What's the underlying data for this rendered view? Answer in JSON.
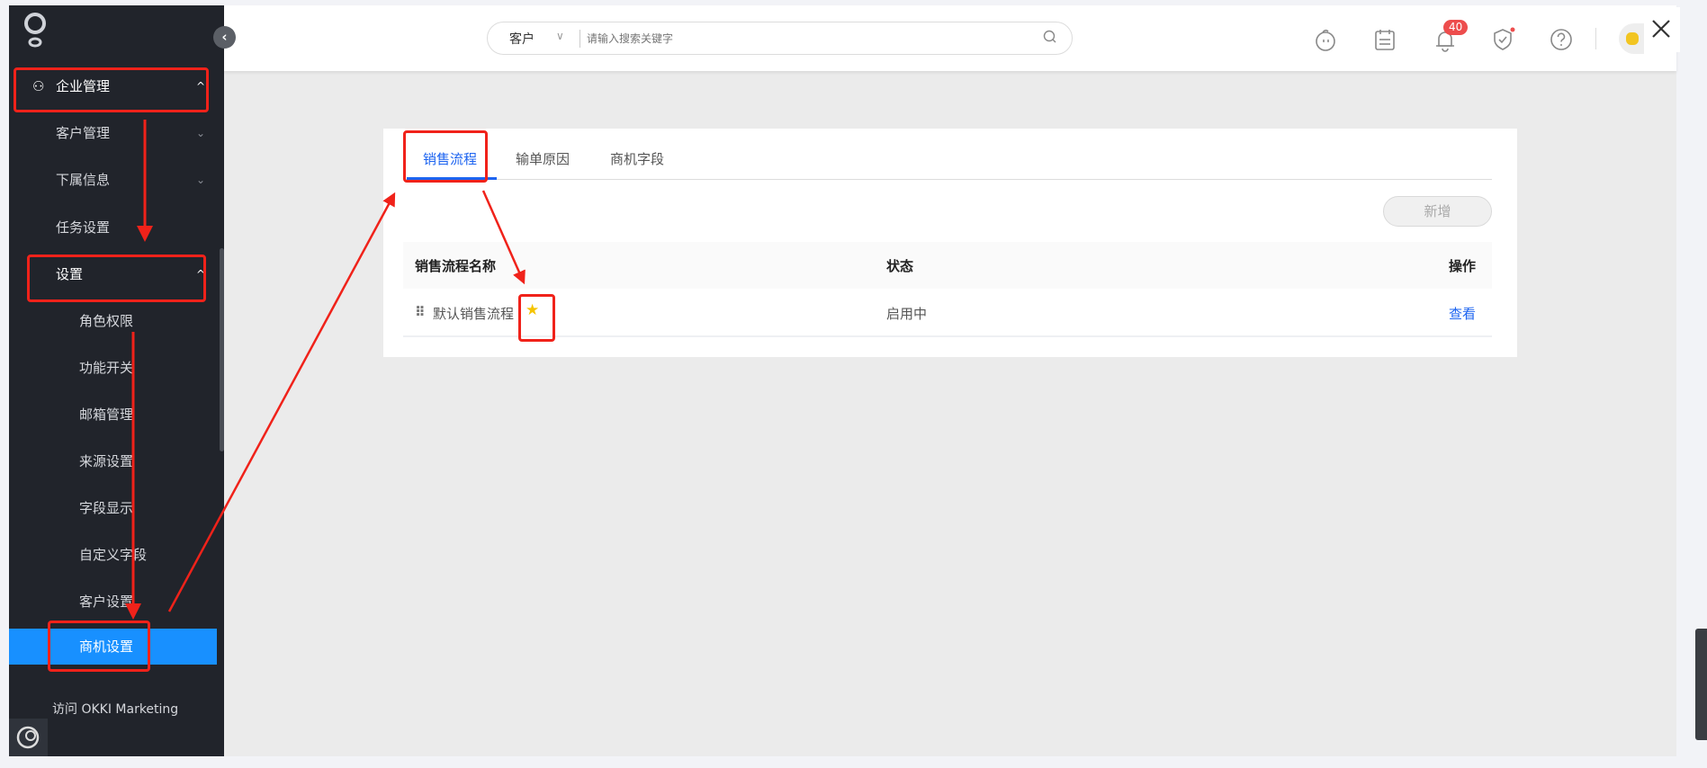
{
  "sidebar": {
    "items": [
      {
        "label": "企业管理",
        "level": 1,
        "expanded": true
      },
      {
        "label": "客户管理",
        "level": 2
      },
      {
        "label": "下属信息",
        "level": 2
      },
      {
        "label": "任务设置",
        "level": 2
      },
      {
        "label": "设置",
        "level": 2,
        "expanded": true
      },
      {
        "label": "角色权限",
        "level": 3
      },
      {
        "label": "功能开关",
        "level": 3
      },
      {
        "label": "邮箱管理",
        "level": 3
      },
      {
        "label": "来源设置",
        "level": 3
      },
      {
        "label": "字段显示",
        "level": 3
      },
      {
        "label": "自定义字段",
        "level": 3
      },
      {
        "label": "客户设置",
        "level": 3
      },
      {
        "label": "商机设置",
        "level": 3,
        "active": true
      }
    ],
    "footer_link": "访问 OKKI Marketing"
  },
  "header": {
    "search_scope": "客户",
    "search_placeholder": "请输入搜索关键字",
    "notification_count": "40"
  },
  "tabs": [
    "销售流程",
    "输单原因",
    "商机字段"
  ],
  "new_button": "新增",
  "table": {
    "columns": [
      "销售流程名称",
      "状态",
      "操作"
    ],
    "rows": [
      {
        "name": "默认销售流程",
        "status": "启用中",
        "action": "查看",
        "starred": true
      }
    ]
  },
  "colors": {
    "accent": "#1890ff",
    "annotation": "#f0221a",
    "star": "#f5c400"
  }
}
